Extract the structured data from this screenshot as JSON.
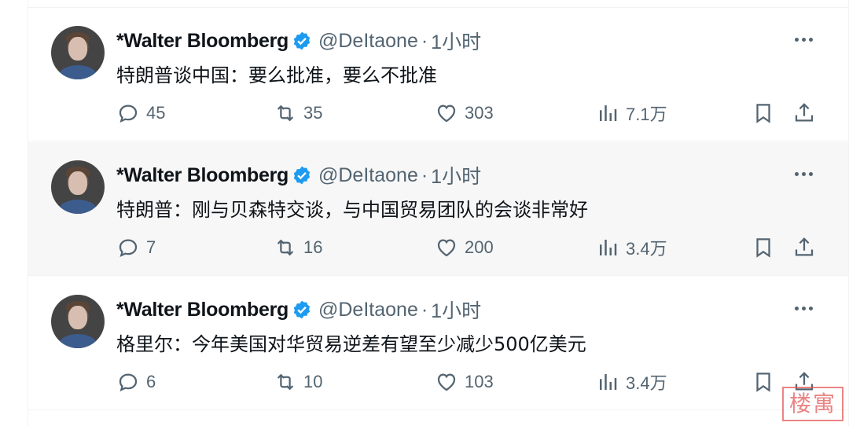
{
  "feed": {
    "tweets": [
      {
        "name": "*Walter Bloomberg",
        "handle": "@DeItaone",
        "separator": "·",
        "time": "1小时",
        "text": "特朗普谈中国：要么批准，要么不批准",
        "replies": "45",
        "retweets": "35",
        "likes": "303",
        "views": "7.1万",
        "highlighted": false
      },
      {
        "name": "*Walter Bloomberg",
        "handle": "@DeItaone",
        "separator": "·",
        "time": "1小时",
        "text": "特朗普：刚与贝森特交谈，与中国贸易团队的会谈非常好",
        "replies": "7",
        "retweets": "16",
        "likes": "200",
        "views": "3.4万",
        "highlighted": true
      },
      {
        "name": "*Walter Bloomberg",
        "handle": "@DeItaone",
        "separator": "·",
        "time": "1小时",
        "text": "格里尔：今年美国对华贸易逆差有望至少减少500亿美元",
        "replies": "6",
        "retweets": "10",
        "likes": "103",
        "views": "3.4万",
        "highlighted": false
      }
    ]
  },
  "colors": {
    "verified": "#1d9bf0",
    "muted": "#536471",
    "text": "#0f1419",
    "hover_bg": "#f7f7f7",
    "stamp": "#e35b5b"
  },
  "icons": [
    "reply-icon",
    "retweet-icon",
    "like-icon",
    "views-icon",
    "bookmark-icon",
    "share-icon",
    "more-icon",
    "verified-badge-icon"
  ],
  "watermark": {
    "text": "楼寓"
  }
}
